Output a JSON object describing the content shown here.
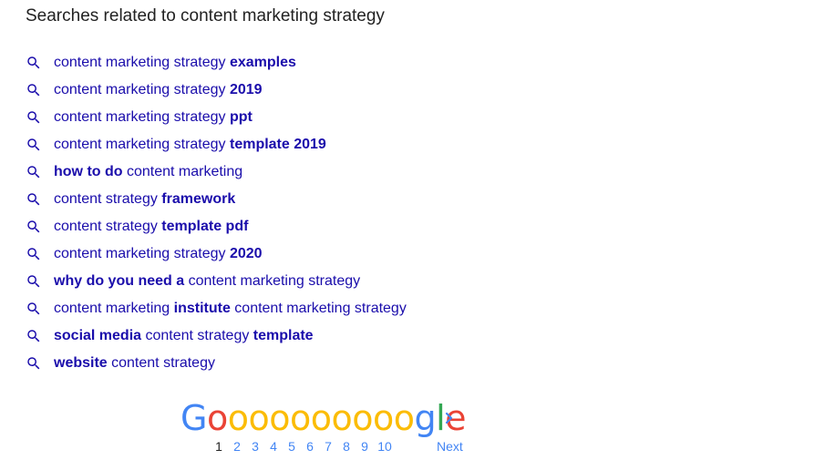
{
  "heading": "Searches related to content marketing strategy",
  "related_searches": [
    {
      "segments": [
        {
          "text": "content marketing strategy ",
          "bold": false
        },
        {
          "text": "examples",
          "bold": true
        }
      ]
    },
    {
      "segments": [
        {
          "text": "content marketing strategy ",
          "bold": false
        },
        {
          "text": "2019",
          "bold": true
        }
      ]
    },
    {
      "segments": [
        {
          "text": "content marketing strategy ",
          "bold": false
        },
        {
          "text": "ppt",
          "bold": true
        }
      ]
    },
    {
      "segments": [
        {
          "text": "content marketing strategy ",
          "bold": false
        },
        {
          "text": "template 2019",
          "bold": true
        }
      ]
    },
    {
      "segments": [
        {
          "text": "how to do",
          "bold": true
        },
        {
          "text": " content marketing",
          "bold": false
        }
      ]
    },
    {
      "segments": [
        {
          "text": "content strategy ",
          "bold": false
        },
        {
          "text": "framework",
          "bold": true
        }
      ]
    },
    {
      "segments": [
        {
          "text": "content strategy ",
          "bold": false
        },
        {
          "text": "template pdf",
          "bold": true
        }
      ]
    },
    {
      "segments": [
        {
          "text": "content marketing strategy ",
          "bold": false
        },
        {
          "text": "2020",
          "bold": true
        }
      ]
    },
    {
      "segments": [
        {
          "text": "why do you need a",
          "bold": true
        },
        {
          "text": " content marketing strategy",
          "bold": false
        }
      ]
    },
    {
      "segments": [
        {
          "text": "content marketing ",
          "bold": false
        },
        {
          "text": "institute",
          "bold": true
        },
        {
          "text": " content marketing strategy",
          "bold": false
        }
      ]
    },
    {
      "segments": [
        {
          "text": "social media",
          "bold": true
        },
        {
          "text": " content strategy ",
          "bold": false
        },
        {
          "text": "template",
          "bold": true
        }
      ]
    },
    {
      "segments": [
        {
          "text": "website",
          "bold": true
        },
        {
          "text": " content strategy",
          "bold": false
        }
      ]
    }
  ],
  "icons": {
    "search": "search-icon",
    "next": "chevron-right-icon"
  },
  "pagination": {
    "logo": {
      "letters": [
        {
          "char": "G",
          "color": "#4285f4"
        },
        {
          "char": "o",
          "color": "#ea4335"
        },
        {
          "char": "o",
          "color": "#fbbc05"
        },
        {
          "char": "o",
          "color": "#fbbc05"
        },
        {
          "char": "o",
          "color": "#fbbc05"
        },
        {
          "char": "o",
          "color": "#fbbc05"
        },
        {
          "char": "o",
          "color": "#fbbc05"
        },
        {
          "char": "o",
          "color": "#fbbc05"
        },
        {
          "char": "o",
          "color": "#fbbc05"
        },
        {
          "char": "o",
          "color": "#fbbc05"
        },
        {
          "char": "o",
          "color": "#fbbc05"
        },
        {
          "char": "g",
          "color": "#4285f4"
        },
        {
          "char": "l",
          "color": "#34a853"
        },
        {
          "char": "e",
          "color": "#ea4335"
        }
      ]
    },
    "pages": [
      "1",
      "2",
      "3",
      "4",
      "5",
      "6",
      "7",
      "8",
      "9",
      "10"
    ],
    "current_page": "1",
    "next_label": "Next"
  },
  "colors": {
    "link": "#1a0dab",
    "heading": "#222222",
    "pager_link": "#4285f4",
    "icon": "#1a0dab"
  }
}
